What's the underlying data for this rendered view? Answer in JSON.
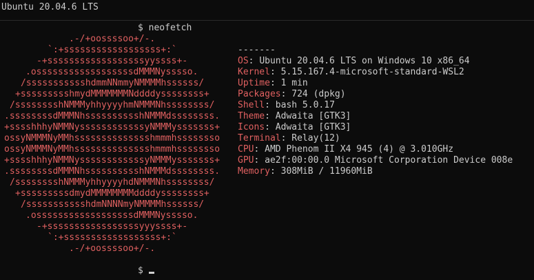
{
  "window": {
    "title": "Ubuntu 20.04.6 LTS"
  },
  "prompt": {
    "symbol": "$",
    "command": "neofetch"
  },
  "logo": [
    ".-/+oossssoo+/-.",
    "`:+ssssssssssssssssss+:`",
    "-+ssssssssssssssssssyyssss+-",
    ".ossssssssssssssssssdMMMNysssso.",
    "/ssssssssssshdmmNNmmyNMMMMhssssss/",
    "+ssssssssshmydMMMMMMMNddddyssssssss+",
    "/sssssssshNMMMyhhyyyyhmNMMMNhssssssss/",
    ".ssssssssdMMMNhsssssssssshNMMMdssssssss.",
    "+sssshhhyNMMNyssssssssssssyNMMMysssssss+",
    "ossyNMMMNyMMhsssssssssssssshmmmhssssssso",
    "ossyNMMMNyMMhsssssssssssssshmmmhssssssso",
    "+sssshhhyNMMNyssssssssssssyNMMMysssssss+",
    ".ssssssssdMMMNhsssssssssshNMMMdssssssss.",
    "/sssssssshNMMMyhhyyyyhdNMMMNhssssssss/",
    "+sssssssssdmydMMMMMMMMddddyssssssss+",
    "/ssssssssssshdmNNNNmyNMMMMhssssss/",
    ".ossssssssssssssssssdMMMNysssso.",
    "-+sssssssssssssssssyyyssss+-",
    "`:+ssssssssssssssssss+:`",
    ".-/+oossssoo+/-."
  ],
  "info": {
    "separator": "-------",
    "rows": [
      {
        "key": "OS",
        "value": "Ubuntu 20.04.6 LTS on Windows 10 x86_64"
      },
      {
        "key": "Kernel",
        "value": "5.15.167.4-microsoft-standard-WSL2"
      },
      {
        "key": "Uptime",
        "value": "1 min"
      },
      {
        "key": "Packages",
        "value": "724 (dpkg)"
      },
      {
        "key": "Shell",
        "value": "bash 5.0.17"
      },
      {
        "key": "Theme",
        "value": "Adwaita [GTK3]"
      },
      {
        "key": "Icons",
        "value": "Adwaita [GTK3]"
      },
      {
        "key": "Terminal",
        "value": "Relay(12)"
      },
      {
        "key": "CPU",
        "value": "AMD Phenom II X4 945 (4) @ 3.010GHz"
      },
      {
        "key": "GPU",
        "value": "ae2f:00:00.0 Microsoft Corporation Device 008e"
      },
      {
        "key": "Memory",
        "value": "308MiB / 11960MiB"
      }
    ]
  },
  "colors": {
    "accent": "#e06060",
    "text": "#cccccc",
    "background": "#0c0c0c"
  }
}
